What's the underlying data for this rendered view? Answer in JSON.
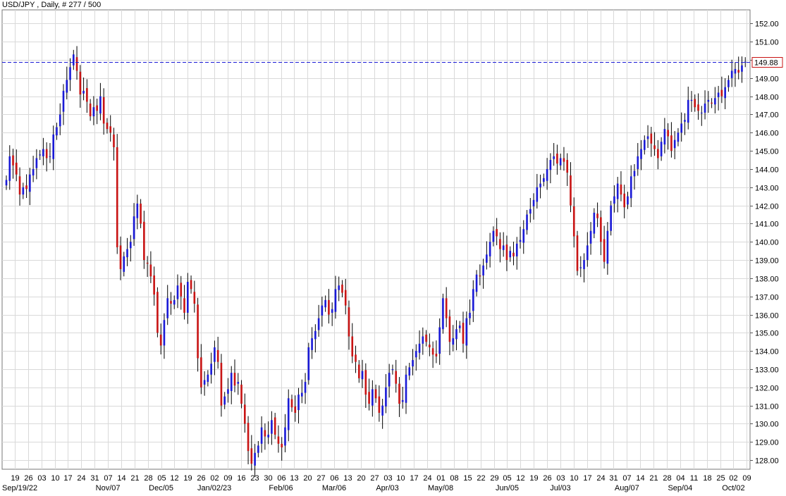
{
  "header": {
    "title": "USD/JPY , Daily, # 277 / 500"
  },
  "chart_data": {
    "type": "candlestick",
    "symbol": "USD/JPY",
    "timeframe": "Daily",
    "ylim": [
      127.5,
      152.75
    ],
    "y_ticks": [
      "152.00",
      "151.00",
      "150.00",
      "149.00",
      "148.00",
      "147.00",
      "146.00",
      "145.00",
      "144.00",
      "143.00",
      "142.00",
      "141.00",
      "140.00",
      "139.00",
      "138.00",
      "137.00",
      "136.00",
      "135.00",
      "134.00",
      "133.00",
      "132.00",
      "131.00",
      "130.00",
      "129.00",
      "128.00"
    ],
    "x_tick_labels": [
      "19",
      "26",
      "03",
      "10",
      "17",
      "24",
      "31",
      "07",
      "14",
      "21",
      "28",
      "05",
      "12",
      "19",
      "26",
      "02",
      "09",
      "16",
      "23",
      "30",
      "06",
      "13",
      "20",
      "27",
      "06",
      "13",
      "20",
      "27",
      "03",
      "10",
      "17",
      "24",
      "01",
      "08",
      "15",
      "22",
      "29",
      "05",
      "12",
      "19",
      "26",
      "03",
      "10",
      "17",
      "24",
      "31",
      "07",
      "14",
      "21",
      "28",
      "04",
      "11",
      "18",
      "25",
      "02",
      "09"
    ],
    "x_period_labels": [
      "Sep/19/22",
      "Nov/07",
      "Dec/05",
      "Jan/02/23",
      "Feb/06",
      "Mar/06",
      "Apr/03",
      "May/08",
      "Jun/05",
      "Jul/03",
      "Aug/07",
      "Sep/04",
      "Oct/02"
    ],
    "current_price": "149.88",
    "grid": true,
    "colors": {
      "up": "#1a1ad6",
      "down": "#c81414",
      "hline": "#1a1ad6",
      "grid": "#d9d9d9",
      "price_box": "#c81414"
    },
    "closes": [
      143.4,
      144.7,
      144.2,
      143.7,
      142.6,
      143.0,
      142.9,
      143.7,
      144.0,
      144.6,
      144.8,
      145.1,
      144.6,
      144.7,
      145.9,
      146.3,
      147.0,
      148.3,
      148.9,
      149.6,
      150.3,
      149.4,
      148.1,
      148.3,
      147.7,
      146.9,
      147.4,
      147.2,
      148.0,
      146.5,
      146.2,
      146.0,
      145.2,
      139.7,
      138.5,
      139.2,
      139.6,
      140.0,
      141.4,
      142.1,
      141.0,
      139.0,
      138.8,
      138.1,
      137.1,
      135.0,
      134.3,
      135.7,
      136.9,
      136.6,
      136.8,
      137.6,
      137.0,
      136.1,
      137.8,
      137.4,
      136.6,
      133.6,
      132.0,
      132.4,
      132.7,
      133.3,
      134.2,
      133.4,
      131.0,
      131.5,
      131.9,
      132.8,
      132.1,
      132.3,
      131.1,
      130.0,
      128.5,
      127.8,
      128.4,
      128.8,
      129.8,
      129.3,
      129.4,
      130.2,
      129.4,
      128.9,
      128.7,
      129.8,
      131.4,
      130.9,
      130.6,
      131.6,
      131.7,
      132.3,
      134.2,
      134.7,
      135.1,
      135.8,
      136.5,
      136.8,
      136.0,
      136.3,
      137.4,
      137.6,
      137.2,
      136.5,
      134.8,
      133.7,
      133.4,
      132.5,
      132.9,
      131.6,
      131.1,
      131.9,
      131.4,
      130.6,
      131.0,
      132.0,
      132.8,
      133.0,
      132.2,
      131.1,
      131.3,
      132.7,
      133.1,
      133.5,
      134.0,
      134.4,
      134.8,
      134.5,
      134.2,
      133.8,
      133.7,
      135.3,
      136.9,
      135.8,
      134.5,
      134.7,
      135.2,
      135.4,
      134.4,
      135.8,
      136.1,
      137.4,
      138.2,
      138.1,
      138.7,
      139.3,
      140.0,
      140.6,
      140.3,
      139.6,
      139.8,
      139.0,
      139.5,
      139.2,
      139.9,
      140.1,
      140.7,
      141.5,
      141.8,
      142.3,
      143.0,
      143.2,
      143.5,
      144.0,
      144.5,
      144.7,
      144.3,
      144.6,
      144.4,
      143.8,
      142.0,
      140.3,
      138.4,
      138.6,
      139.0,
      139.8,
      140.6,
      141.6,
      141.3,
      140.0,
      138.9,
      140.6,
      142.0,
      142.5,
      143.2,
      142.6,
      141.9,
      142.5,
      143.6,
      143.9,
      144.7,
      145.1,
      145.6,
      145.8,
      145.4,
      145.1,
      144.6,
      145.5,
      146.2,
      145.8,
      145.0,
      145.6,
      146.0,
      146.5,
      146.7,
      147.8,
      147.8,
      147.4,
      147.2,
      147.1,
      147.6,
      147.8,
      147.6,
      147.9,
      148.2,
      148.0,
      148.5,
      148.9,
      149.4,
      149.5,
      149.3,
      149.7,
      149.9
    ]
  }
}
